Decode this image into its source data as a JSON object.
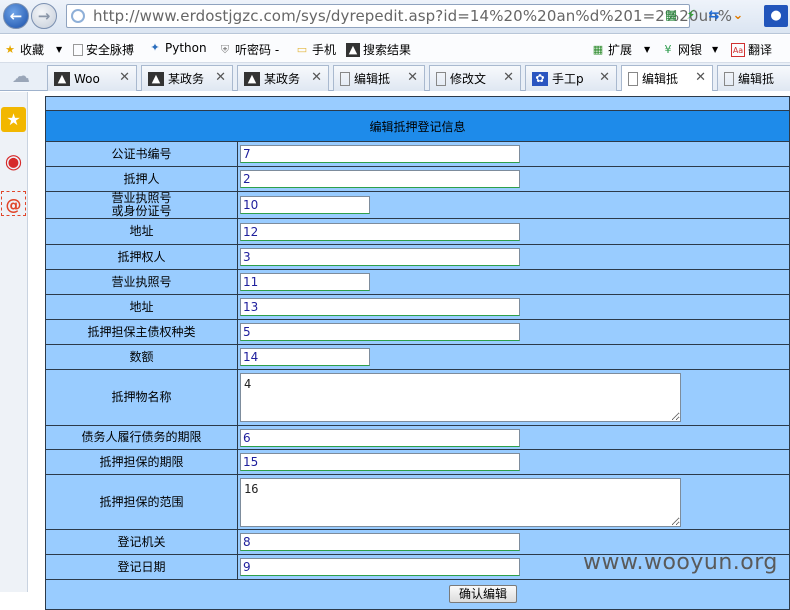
{
  "browser": {
    "url": "http://www.erdostjgzc.com/sys/dyrepedit.asp?id=14%20%20an%d%201=2%20un%"
  },
  "bookmarks": [
    {
      "label": "收藏",
      "icon": "star-icon"
    },
    {
      "label": "安全脉搏",
      "icon": "page-icon"
    },
    {
      "label": "Python",
      "icon": "python-icon"
    },
    {
      "label": "听密码 -",
      "icon": "shield-icon"
    },
    {
      "label": "手机",
      "icon": "folder-icon"
    },
    {
      "label": "搜索结果",
      "icon": "image-icon"
    },
    {
      "label": "扩展",
      "icon": "extension-icon"
    },
    {
      "label": "网银",
      "icon": "bank-icon"
    },
    {
      "label": "翻译",
      "icon": "translate-icon"
    }
  ],
  "tabs": [
    {
      "label": "Woo",
      "icon": "wooyun-icon"
    },
    {
      "label": "某政务",
      "icon": "wooyun-icon"
    },
    {
      "label": "某政务",
      "icon": "wooyun-icon"
    },
    {
      "label": "编辑抵",
      "icon": "page-icon"
    },
    {
      "label": "修改文",
      "icon": "page-icon"
    },
    {
      "label": "手工p",
      "icon": "paw-icon"
    },
    {
      "label": "编辑抵",
      "icon": "page-icon"
    },
    {
      "label": "编辑抵",
      "icon": "page-icon"
    }
  ],
  "form": {
    "title": "编辑抵押登记信息",
    "rows": [
      {
        "label": "公证书编号",
        "value": "7"
      },
      {
        "label": "抵押人",
        "value": "2"
      },
      {
        "label": "营业执照号\n或身份证号",
        "value": "10"
      },
      {
        "label": "地址",
        "value": "12"
      },
      {
        "label": "抵押权人",
        "value": "3"
      },
      {
        "label": "营业执照号",
        "value": "11"
      },
      {
        "label": "地址",
        "value": "13"
      },
      {
        "label": "抵押担保主债权种类",
        "value": "5"
      },
      {
        "label": "数额",
        "value": "14"
      },
      {
        "label": "抵押物名称",
        "value": "4"
      },
      {
        "label": "债务人履行债务的期限",
        "value": "6"
      },
      {
        "label": "抵押担保的期限",
        "value": "15"
      },
      {
        "label": "抵押担保的范围",
        "value": "16"
      },
      {
        "label": "登记机关",
        "value": "8"
      },
      {
        "label": "登记日期",
        "value": "9"
      }
    ],
    "submit_label": "确认编辑"
  },
  "watermark": "www.wooyun.org"
}
